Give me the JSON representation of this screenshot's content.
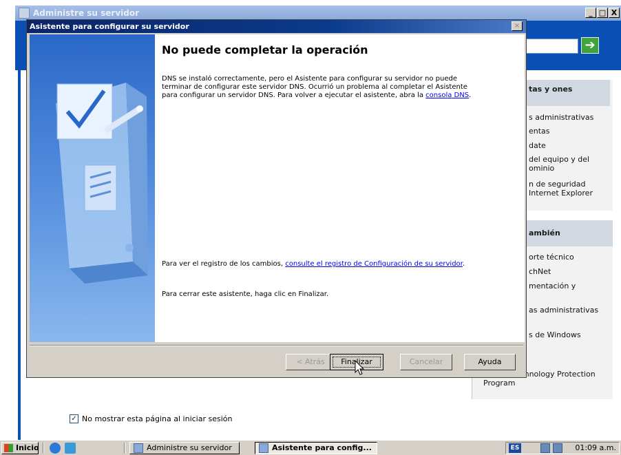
{
  "background_window": {
    "title": "Administre su servidor",
    "controls": {
      "minimize": "_",
      "maximize": "□",
      "close": "X"
    },
    "go_button": "➔",
    "panel1": {
      "heading": "tas y ones",
      "items": [
        "s administrativas",
        "entas",
        "date",
        "del equipo y del ominio",
        "n de seguridad Internet Explorer"
      ]
    },
    "panel2": {
      "heading": "ambién",
      "items": [
        "orte técnico",
        "chNet",
        "mentación y",
        "as administrativas",
        "s de Windows",
        "rategic Technology Protection Program"
      ]
    },
    "no_show_label": "No mostrar esta página al iniciar sesión",
    "no_show_checked_mark": "✓"
  },
  "dialog": {
    "title": "Asistente para configurar su servidor",
    "close_glyph": "×",
    "heading": "No puede completar la operación",
    "para1": "DNS se instaló correctamente, pero el Asistente para configurar su servidor no puede terminar de configurar este servidor DNS. Ocurrió un problema al completar el Asistente para configurar un servidor DNS. Para volver a ejecutar el asistente, abra la ",
    "para1_link": "consola DNS",
    "para1_end": ".",
    "para2": "Para ver el registro de los cambios, ",
    "para2_link": "consulte el registro de Configuración de su servidor",
    "para2_end": ".",
    "para3": "Para cerrar este asistente, haga clic en Finalizar.",
    "buttons": {
      "back": "< Atrás",
      "finish": "Finalizar",
      "cancel": "Cancelar",
      "help": "Ayuda"
    }
  },
  "taskbar": {
    "start": "Inicio",
    "tasks": [
      "Administre su servidor",
      "Asistente para config..."
    ],
    "lang": "ES",
    "clock": "01:09 a.m."
  },
  "colors": {
    "header_blue": "#0a50b4",
    "title_blue": "#0a246a",
    "link": "#0000ee",
    "go_green": "#3fa43c"
  }
}
